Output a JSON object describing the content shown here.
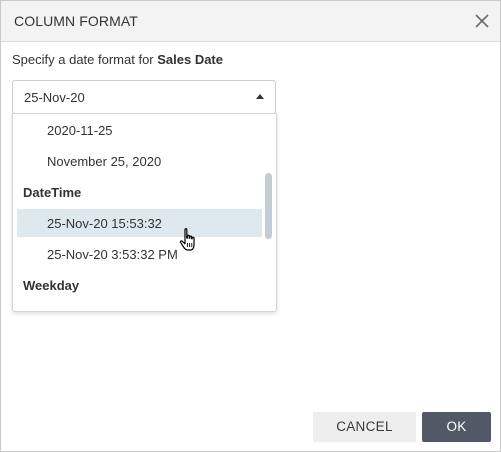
{
  "dialog": {
    "title": "COLUMN FORMAT",
    "prompt_text": "Specify a date format for ",
    "prompt_field": "Sales Date"
  },
  "select": {
    "value": "25-Nov-20"
  },
  "dropdown": {
    "item_iso": "2020-11-25",
    "item_long": "November 25, 2020",
    "group_datetime": "DateTime",
    "item_dt24": "25-Nov-20 15:53:32",
    "item_dt12": "25-Nov-20 3:53:32 PM",
    "group_weekday": "Weekday",
    "hovered_item": "25-Nov-20 15:53:32"
  },
  "buttons": {
    "cancel": "CANCEL",
    "ok": "OK"
  },
  "colors": {
    "titlebar_bg": "#f3f3f3",
    "hover_bg": "#dde8ef",
    "ok_bg": "#525866",
    "cancel_bg": "#eeeeee"
  },
  "icons": {
    "close": "close-icon",
    "caret": "caret-up-icon",
    "cursor": "hand-pointer-icon"
  }
}
